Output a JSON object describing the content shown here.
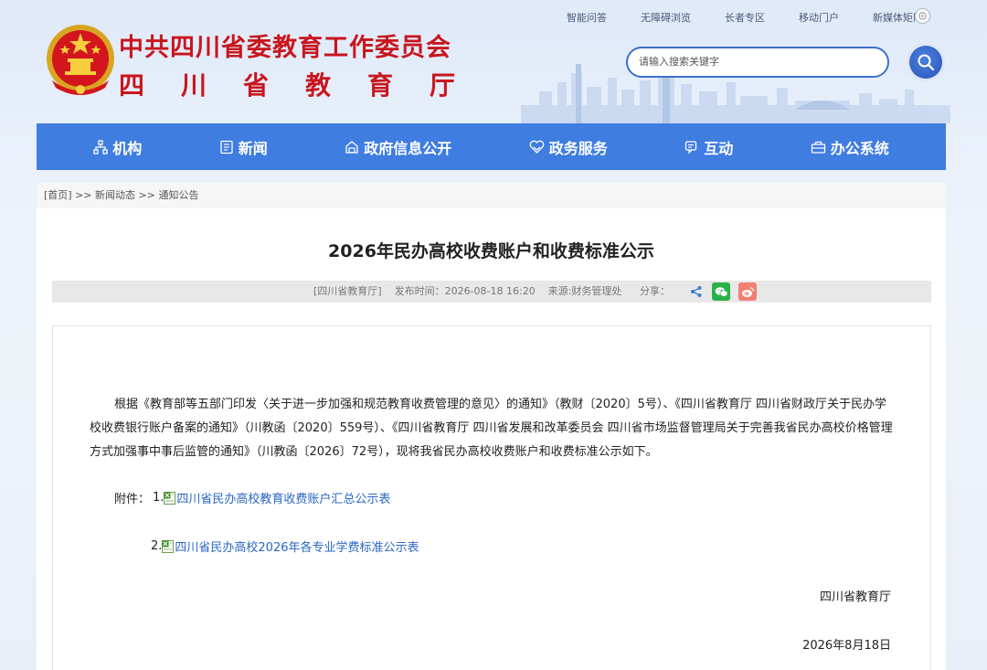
{
  "header": {
    "org_name": "中共四川省委教育工作委员会",
    "dept_name": "四川省教育厅",
    "top_links": [
      "智能问答",
      "无障碍浏览",
      "长者专区",
      "移动门户",
      "新媒体矩阵"
    ],
    "search": {
      "placeholder": "请输入搜索关键字"
    }
  },
  "nav": [
    {
      "label": "机构",
      "icon": "org-icon"
    },
    {
      "label": "新闻",
      "icon": "news-icon"
    },
    {
      "label": "政府信息公开",
      "icon": "info-icon"
    },
    {
      "label": "政务服务",
      "icon": "service-icon"
    },
    {
      "label": "互动",
      "icon": "chat-icon"
    },
    {
      "label": "办公系统",
      "icon": "office-icon"
    }
  ],
  "breadcrumb": {
    "home": "[首页]",
    "sep1": " >> ",
    "level1": "新闻动态",
    "sep2": " >> ",
    "level2": "通知公告"
  },
  "article": {
    "title": "2026年民办高校收费账户和收费标准公示",
    "meta": "[四川省教育厅]    发布时间：2026-08-18 16:20    来源:财务管理处",
    "share_label": "分享：",
    "body": "根据《教育部等五部门印发〈关于进一步加强和规范教育收费管理的意见〉的通知》（教财〔2020〕5号）、《四川省教育厅 四川省财政厅关于民办学校收费银行账户备案的通知》（川教函〔2020〕559号）、《四川省教育厅 四川省发展和改革委员会 四川省市场监督管理局关于完善我省民办高校价格管理方式加强事中事后监管的通知》（川教函〔2026〕72号），现将我省民办高校收费账户和收费标准公示如下。",
    "attach_label": "附件：",
    "attachments": [
      {
        "num": "1.",
        "name": "四川省民办高校教育收费账户汇总公示表"
      },
      {
        "num": "2.",
        "name": "四川省民办高校2026年各专业学费标准公示表"
      }
    ],
    "signature": "四川省教育厅",
    "date": "2026年8月18日"
  },
  "colors": {
    "nav_bg": "#3f7de0",
    "title_red": "#c8161e",
    "link_blue": "#2a66c4"
  }
}
